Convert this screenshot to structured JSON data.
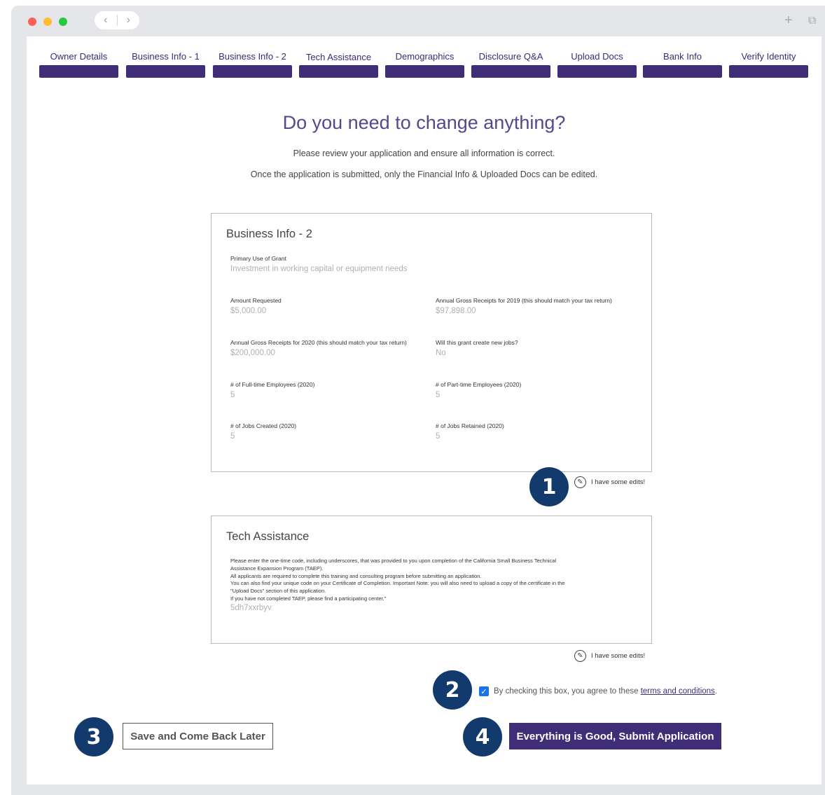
{
  "window": {
    "controls": {
      "close_color": "#ff5f57",
      "minimize_color": "#febc2e",
      "zoom_color": "#28c840"
    },
    "nav": {
      "back_symbol": "‹",
      "forward_symbol": "›"
    },
    "new_tab_symbol": "+",
    "tabs_symbol": "⧉"
  },
  "steps": [
    {
      "label": "Owner Details"
    },
    {
      "label": "Business Info - 1"
    },
    {
      "label": "Business Info - 2"
    },
    {
      "label": "Tech Assistance"
    },
    {
      "label": "Demographics"
    },
    {
      "label": "Disclosure Q&A"
    },
    {
      "label": "Upload Docs"
    },
    {
      "label": "Bank Info"
    },
    {
      "label": "Verify Identity"
    }
  ],
  "header": {
    "title": "Do you need to change anything?",
    "subtitle": "Please review your application and ensure all information is correct.",
    "note": "Once the application is submitted, only the Financial Info & Uploaded Docs can be edited."
  },
  "business_info_2": {
    "title": "Business Info - 2",
    "fields": [
      {
        "label": "Primary Use of Grant",
        "value": "Investment in working capital or equipment needs"
      },
      {
        "label": "Amount Requested",
        "value": "$5,000.00"
      },
      {
        "label": "Annual Gross Receipts for 2019 (this should match your tax return)",
        "value": "$97,898.00"
      },
      {
        "label": "Annual Gross Receipts for 2020 (this should match your tax return)",
        "value": "$200,000.00"
      },
      {
        "label": "Will this grant create new jobs?",
        "value": "No"
      },
      {
        "label": "# of Full-time Employees (2020)",
        "value": "5"
      },
      {
        "label": "# of Part-time Employees (2020)",
        "value": "5"
      },
      {
        "label": "# of Jobs Created (2020)",
        "value": "5"
      },
      {
        "label": "# of Jobs Retained (2020)",
        "value": "5"
      }
    ],
    "edit_label": "I have some edits!"
  },
  "tech_assistance": {
    "title": "Tech Assistance",
    "description": [
      "Please enter the one-time code, including underscores, that was provided to you upon completion of the California Small Business Technical",
      "Assistance Expansion Program (TAEP).",
      "All applicants are required to complete this training and consulting program before submitting an application.",
      "You can also find your unique code on your Certificate of Completion. Important Note: you will also need to upload a copy of the certificate in the",
      "\"Upload Docs\" section of this application.",
      "If you have not completed TAEP, please find a participating center.\""
    ],
    "value": "5dh7xxrbyv",
    "edit_label": "I have some edits!"
  },
  "agreement": {
    "checked": true,
    "text": "By checking this box, you agree to these ",
    "link": "terms and conditions",
    "suffix": "."
  },
  "buttons": {
    "save": "Save and Come Back Later",
    "submit": "Everything is Good, Submit Application"
  },
  "badges": [
    "1",
    "2",
    "3",
    "4"
  ],
  "icons": {
    "edit": "pencil-circle-icon",
    "check": "✓"
  },
  "colors": {
    "brand": "#3f2d78",
    "badge": "#123a6c",
    "heading": "#55488f"
  }
}
